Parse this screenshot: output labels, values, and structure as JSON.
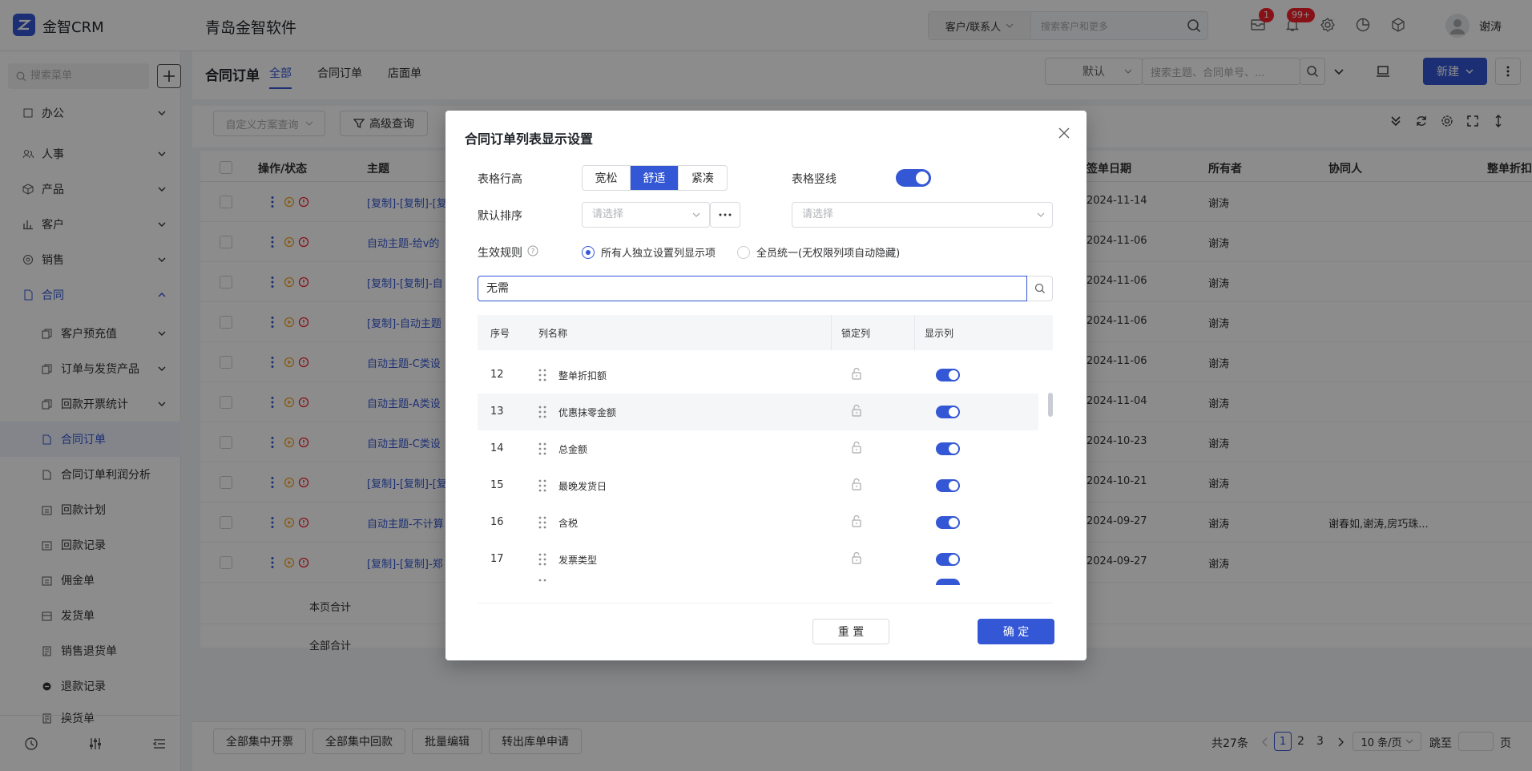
{
  "app": {
    "logo": "金智CRM",
    "company": "青岛金智软件"
  },
  "topbar": {
    "search_type": "客户/联系人",
    "search_placeholder": "搜索客户和更多",
    "mail_badge": "1",
    "notice_badge": "99+",
    "username": "谢涛"
  },
  "sidebar": {
    "search_placeholder": "搜索菜单",
    "items": [
      {
        "label": "办公"
      },
      {
        "label": "人事"
      },
      {
        "label": "产品"
      },
      {
        "label": "客户"
      },
      {
        "label": "销售"
      },
      {
        "label": "合同"
      }
    ],
    "sub_items": [
      {
        "label": "客户预充值"
      },
      {
        "label": "订单与发货产品"
      },
      {
        "label": "回款开票统计"
      },
      {
        "label": "合同订单"
      },
      {
        "label": "合同订单利润分析"
      },
      {
        "label": "回款计划"
      },
      {
        "label": "回款记录"
      },
      {
        "label": "佣金单"
      },
      {
        "label": "发货单"
      },
      {
        "label": "销售退货单"
      },
      {
        "label": "退款记录"
      },
      {
        "label": "换货单"
      }
    ]
  },
  "main": {
    "title": "合同订单",
    "tabs": [
      {
        "label": "全部"
      },
      {
        "label": "合同订单"
      },
      {
        "label": "店面单"
      }
    ],
    "view_select": "默认",
    "search_placeholder": "搜索主题、合同单号、...",
    "new_button": "新建",
    "custom_query": "自定义方案查询",
    "advanced_query": "高级查询",
    "columns": {
      "ops": "操作/状态",
      "subject": "主题",
      "sign_date": "签单日期",
      "owner": "所有者",
      "collab": "协同人",
      "discount": "整单折扣"
    },
    "rows": [
      {
        "subject": "[复制]-[复制]-[复",
        "date": "2024-11-14",
        "owner": "谢涛",
        "collab": ""
      },
      {
        "subject": "自动主题-给v的",
        "date": "2024-11-06",
        "owner": "谢涛",
        "collab": ""
      },
      {
        "subject": "[复制]-[复制]-自",
        "date": "2024-11-06",
        "owner": "谢涛",
        "collab": ""
      },
      {
        "subject": "[复制]-自动主题",
        "date": "2024-11-06",
        "owner": "谢涛",
        "collab": ""
      },
      {
        "subject": "自动主题-C类设",
        "date": "2024-11-06",
        "owner": "谢涛",
        "collab": ""
      },
      {
        "subject": "自动主题-A类设",
        "date": "2024-11-04",
        "owner": "谢涛",
        "collab": ""
      },
      {
        "subject": "自动主题-C类设",
        "date": "2024-10-23",
        "owner": "谢涛",
        "collab": ""
      },
      {
        "subject": "[复制]-[复制]-[复",
        "date": "2024-10-21",
        "owner": "谢涛",
        "collab": ""
      },
      {
        "subject": "自动主题-不计算",
        "date": "2024-09-27",
        "owner": "谢涛",
        "collab": "谢春如,谢涛,房巧珠..."
      },
      {
        "subject": "[复制]-[复制]-郑",
        "date": "2024-09-27",
        "owner": "谢涛",
        "collab": ""
      }
    ],
    "page_total": "本页合计",
    "all_total": "全部合计"
  },
  "footer": {
    "buttons": [
      "全部集中开票",
      "全部集中回款",
      "批量编辑",
      "转出库单申请"
    ],
    "total": "共27条",
    "pages": [
      "1",
      "2",
      "3"
    ],
    "page_size": "10 条/页",
    "jump": "跳至",
    "page_unit": "页"
  },
  "modal": {
    "title": "合同订单列表显示设置",
    "row_height_label": "表格行高",
    "row_height_options": [
      "宽松",
      "舒适",
      "紧凑"
    ],
    "vertical_line_label": "表格竖线",
    "sort_label": "默认排序",
    "sort_placeholder": "请选择",
    "sort_placeholder2": "请选择",
    "rule_label": "生效规则",
    "rule_option1": "所有人独立设置列显示项",
    "rule_option2": "全员统一(无权限列项自动隐藏)",
    "search_value": "无需",
    "head": {
      "no": "序号",
      "name": "列名称",
      "lock": "锁定列",
      "show": "显示列"
    },
    "columns": [
      {
        "no": "12",
        "name": "整单折扣额"
      },
      {
        "no": "13",
        "name": "优惠抹零金额"
      },
      {
        "no": "14",
        "name": "总金额"
      },
      {
        "no": "15",
        "name": "最晚发货日"
      },
      {
        "no": "16",
        "name": "含税"
      },
      {
        "no": "17",
        "name": "发票类型"
      }
    ],
    "reset_button": "重 置",
    "confirm_button": "确 定"
  }
}
